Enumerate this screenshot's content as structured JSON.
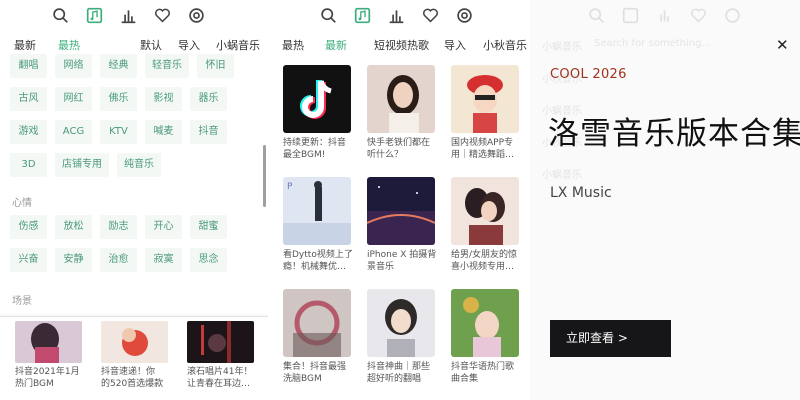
{
  "screen1": {
    "toolbar": {
      "icons": [
        "search-icon",
        "music-library-icon",
        "chart-icon",
        "heart-icon",
        "settings-icon"
      ],
      "active_icon": "music-library-icon"
    },
    "nav": [
      "最新",
      "最热",
      "默认",
      "导入",
      "小蜗音乐"
    ],
    "nav_active": "最热",
    "tag_row_top": [
      "翻唱",
      "网络",
      "经典",
      "轻音乐",
      "怀旧",
      "古风",
      "网红",
      "佛乐",
      "影视",
      "器乐",
      "游戏",
      "ACG",
      "KTV",
      "喊麦",
      "抖音",
      "3D",
      "店铺专用",
      "纯音乐"
    ],
    "section_mood": "心情",
    "mood_tags": [
      "伤感",
      "放松",
      "励志",
      "开心",
      "甜蜜",
      "兴奋",
      "安静",
      "治愈",
      "寂寞",
      "思念"
    ],
    "section_scene": "场景",
    "cards": [
      {
        "title": "抖音2021年1月\n热门BGM"
      },
      {
        "title": "抖音速递！你\n的520首选爆款"
      },
      {
        "title": "滚石唱片41年！\n让青春在耳边…"
      }
    ]
  },
  "screen2": {
    "toolbar": {
      "icons": [
        "search-icon",
        "music-library-icon",
        "chart-icon",
        "heart-icon",
        "settings-icon"
      ],
      "active_icon": "music-library-icon"
    },
    "nav": [
      "最热",
      "最新",
      "短视频热歌",
      "导入",
      "小秋音乐"
    ],
    "nav_active": "最新",
    "cards": [
      {
        "title": "持续更新：抖音\n最全BGM!"
      },
      {
        "title": "快手老铁们都在\n听什么？"
      },
      {
        "title": "国内视频APP专\n用｜精选舞蹈…"
      },
      {
        "title": "看Dytto视频上了\n瘾！机械舞优…"
      },
      {
        "title": "iPhone X 拍摄背\n景音乐"
      },
      {
        "title": "给男/女朋友的惊\n喜小视频专用…"
      },
      {
        "title": "集合！抖音最强\n洗脑BGM"
      },
      {
        "title": "抖音神曲｜那些\n超好听的翻唱"
      },
      {
        "title": "抖音华语热门歌\n曲合集"
      }
    ]
  },
  "screen3": {
    "search_placeholder": "Search for something...",
    "side_items": [
      "小蜗音乐",
      "小秋音乐",
      "小蜗音乐",
      "小秋音乐",
      "小蜗音乐"
    ]
  },
  "promo": {
    "tag": "COOL 2026",
    "title": "洛雪音乐版本合集",
    "subtitle": "LX Music",
    "button_label": "立即查看 >"
  },
  "colors": {
    "accent": "#3cae7c",
    "tag_bg": "#f3f8f5",
    "promo_tag": "#a0311d",
    "promo_button": "#161618"
  }
}
